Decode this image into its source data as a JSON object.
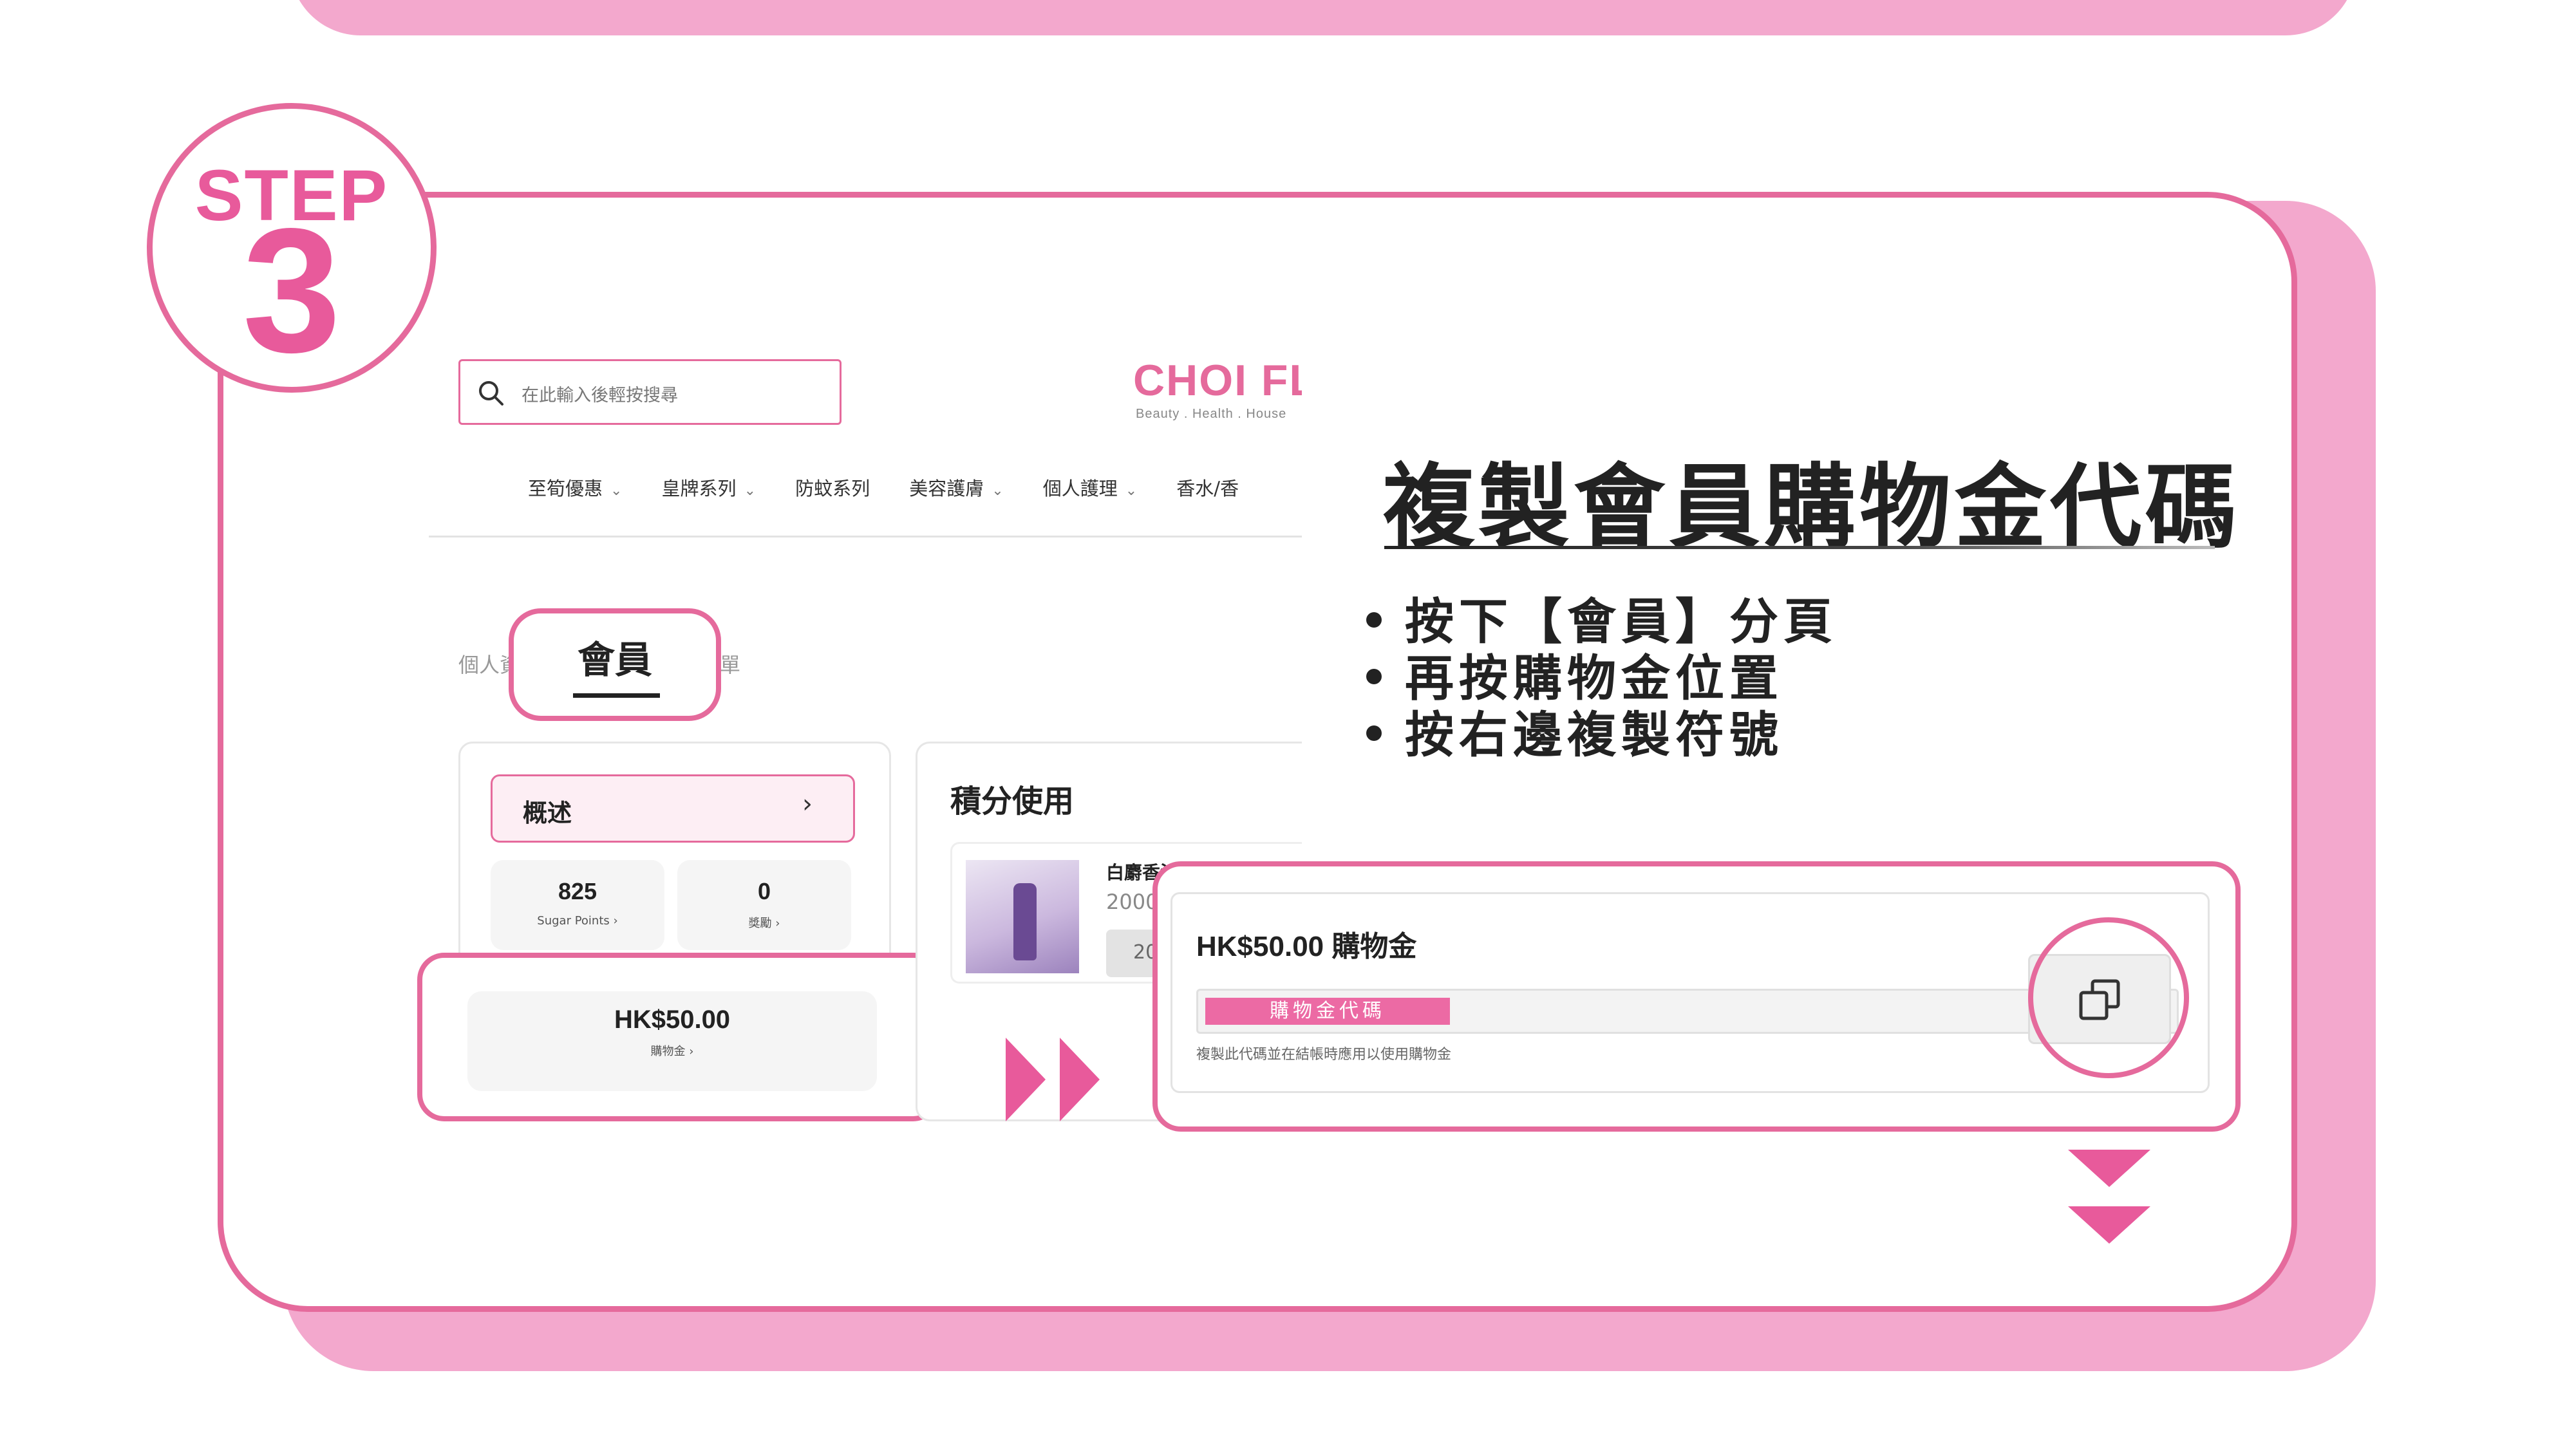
{
  "step": {
    "word": "STEP",
    "number": "3"
  },
  "site": {
    "search_placeholder": "在此輸入後輕按搜尋",
    "logo_name": "CHOI FL",
    "logo_tagline": "Beauty . Health . House",
    "nav": [
      {
        "label": "至筍優惠",
        "has_dropdown": true
      },
      {
        "label": "皇牌系列",
        "has_dropdown": true
      },
      {
        "label": "防蚊系列",
        "has_dropdown": false
      },
      {
        "label": "美容護膚",
        "has_dropdown": true
      },
      {
        "label": "個人護理",
        "has_dropdown": true
      },
      {
        "label": "香水/香",
        "has_dropdown": false
      }
    ],
    "tabs": {
      "left": "個人資",
      "member": "會員",
      "right": "單"
    }
  },
  "account": {
    "overview_label": "概述",
    "points_value": "825",
    "points_label": "Sugar Points ›",
    "rewards_value": "0",
    "rewards_label": "獎勵 ›",
    "coupon_amount": "HK$50.00",
    "coupon_label": "購物金 ›"
  },
  "redeem": {
    "title": "積分使用",
    "product_name": "白麝香沐浴露",
    "product_points": "2000",
    "button_label": "20"
  },
  "instructions": {
    "heading": "複製會員購物金代碼",
    "bullets": [
      "按下【會員】分頁",
      "再按購物金位置",
      "按右邊複製符號"
    ]
  },
  "zoom": {
    "amount_label": "HK$50.00 購物金",
    "code_tag": "購物金代碼",
    "hint": "複製此代碼並在結帳時應用以使用購物金"
  },
  "colors": {
    "accent": "#e56a9c",
    "shadow_pink": "#f3a8cd",
    "brand": "#e85a9b"
  },
  "icons": {
    "search": "search-icon",
    "copy": "copy-icon",
    "chevron": "chevron-right-icon"
  }
}
